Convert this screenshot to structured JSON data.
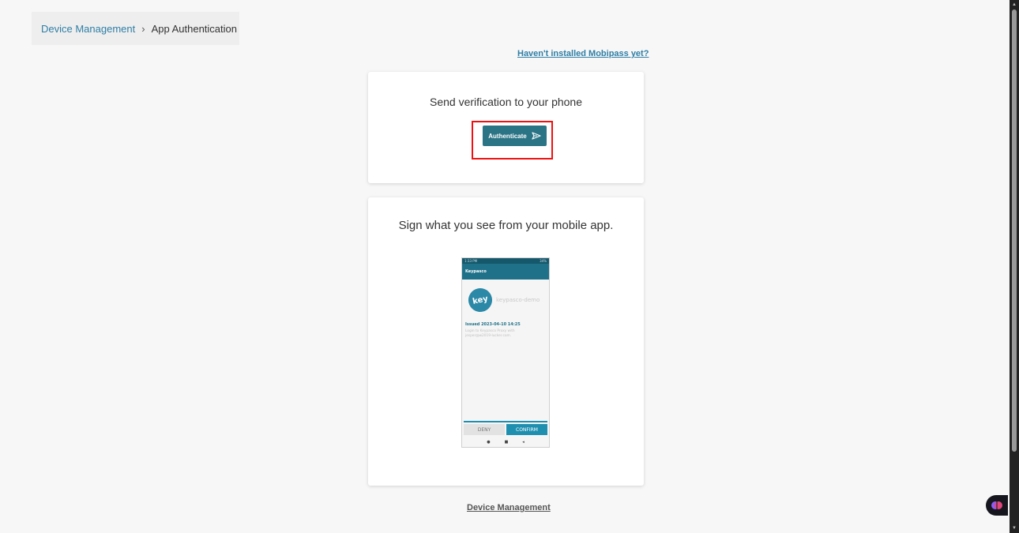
{
  "breadcrumb": {
    "parent": "Device Management",
    "separator": "›",
    "current": "App Authentication"
  },
  "help_link": "Haven't installed Mobipass yet?",
  "auth_card": {
    "title": "Send verification to your phone",
    "button_label": "Authenticate",
    "button_icon": "send-icon",
    "highlight_color": "#ee1111"
  },
  "sign_card": {
    "title": "Sign what you see from your mobile app.",
    "phone": {
      "status_left": "1:33 PM",
      "status_right": "34%",
      "app_name": "Keypasco",
      "logo_text": "key",
      "service_name": "keypasco-demo",
      "issued": "Issued 2023-04-10 14:25",
      "message": "Login to Keypasco Proxy with jesper@w2019-lucker.com.",
      "deny": "DENY",
      "confirm": "CONFIRM",
      "nav": [
        "●",
        "■",
        "◂"
      ]
    }
  },
  "footer_link": "Device Management",
  "colors": {
    "accent": "#2a7486",
    "link": "#2f7fa6",
    "background": "#f7f7f7"
  }
}
